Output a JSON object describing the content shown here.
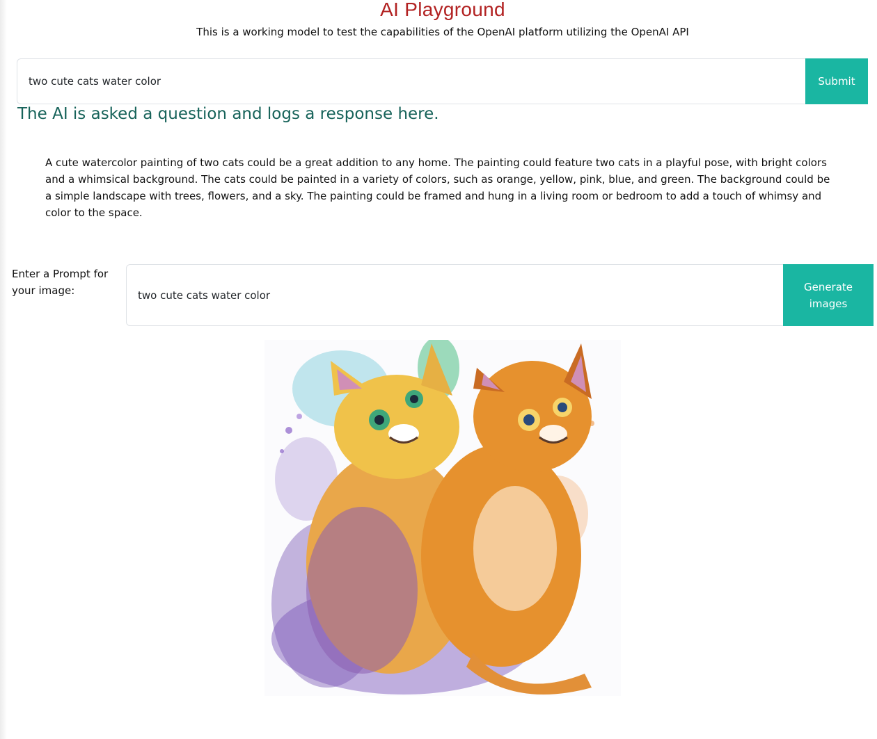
{
  "header": {
    "title": "AI Playground",
    "subtitle": "This is a working model to test the capabilities of the OpenAI platform utilizing the OpenAI API"
  },
  "question": {
    "input_value": "two cute cats water color",
    "submit_label": "Submit"
  },
  "response": {
    "heading": "The AI is asked a question and logs a response here.",
    "text": "A cute watercolor painting of two cats could be a great addition to any home. The painting could feature two cats in a playful pose, with bright colors and a whimsical background. The cats could be painted in a variety of colors, such as orange, yellow, pink, blue, and green. The background could be a simple landscape with trees, flowers, and a sky. The painting could be framed and hung in a living room or bedroom to add a touch of whimsy and color to the space."
  },
  "image_prompt": {
    "label": "Enter a Prompt for your image:",
    "input_value": "two cute cats water color",
    "generate_label": "Generate images"
  },
  "generated_image": {
    "icon": "watercolor-cats-image"
  },
  "colors": {
    "title": "#b22222",
    "heading": "#17635a",
    "button": "#1ab6a2"
  }
}
